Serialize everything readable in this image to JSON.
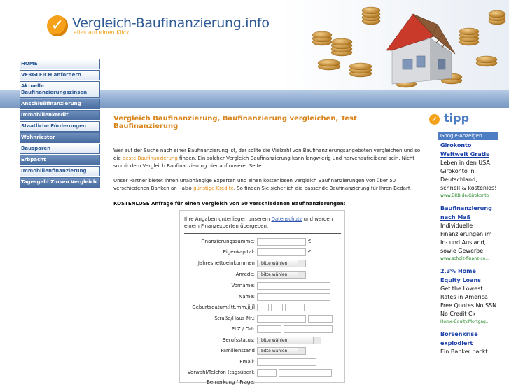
{
  "header": {
    "logo_title": "Vergleich-Baufinanzierung.info",
    "logo_tagline": "alles auf einen Klick."
  },
  "menu": {
    "items": [
      {
        "label": "HOME"
      },
      {
        "label": "VERGLEICH anfordern"
      },
      {
        "label": "Aktuelle Baufinanzierungszinsen"
      },
      {
        "label": "Anschlußfinanzierung"
      },
      {
        "label": "Immobilienkredit"
      },
      {
        "label": "Staatliche Förderungen"
      },
      {
        "label": "Wohnriester"
      },
      {
        "label": "Bausparen"
      },
      {
        "label": "Erbpacht"
      },
      {
        "label": "Immobilienfinanzierung"
      },
      {
        "label": "Tagesgeld Zinsen Vergleich"
      }
    ]
  },
  "main": {
    "title": "Vergleich Baufinanzierung, Baufinanzierung vergleichen, Test Baufinanzierung",
    "para1_a": "Wer auf der Suche nach einer Baufinanzierung ist, der sollte die Vielzahl von Baufinanzierungsangeboten vergleichen und so die ",
    "para1_link": "beste Baufinanzierung",
    "para1_b": " finden. Ein solcher Vergleich Baufinanzierung kann langwierig und nervenaufreibend sein. Nicht so mit dem Vergleich Baufinanzierung hier auf unserer Seite.",
    "para2_a": "Unser Partner bietet Ihnen unabhängige Experten und einen kostenlosen Vergleich Baufinanzierungen von über 50 verschiedenen Banken an - also ",
    "para2_link": "günstige Kredite",
    "para2_b": ". So finden Sie sicherlich die passende Baufinanzierung für Ihren Bedarf.",
    "form_heading": "KOSTENLOSE Anfrage für einen Vergleich von 50 verschiedenen Baufinanzierungen:"
  },
  "form": {
    "intro_a": "Ihre Angaben unterliegen unserem ",
    "intro_link": "Datenschutz",
    "intro_b": " und werden einem Finanzexperten übergeben.",
    "labels": {
      "finanzierungssumme": "Finanzierungssumme:",
      "eigenkapital": "Eigenkapital:",
      "jahresnetto": "Jahresnettoeinkommen",
      "anrede": "Anrede:",
      "vorname": "Vorname:",
      "name": "Name:",
      "geburtsdatum": "Geburtsdatum:[tt.mm.jjjj]",
      "strasse": "Straße/Haus-Nr.:",
      "plz": "PLZ / Ort:",
      "berufsstatus": "Berufsstatus:",
      "familienstand": "Familienstand",
      "email": "Email:",
      "telefon": "Vorwahl/Telefon (tagsüber):",
      "bemerkung": "Bemerkung / Frage:"
    },
    "euro": "€",
    "select_placeholder": "bitte wählen"
  },
  "sidebar_right": {
    "tipp": "tipp",
    "ads_header": "Google-Anzeigen",
    "ads": [
      {
        "title": "Girokonto Weltweit Gratis",
        "body": "Leben in den USA, Girokonto in Deutschland, schnell & kostenlos!",
        "url": "www.DKB.de/Girokonto"
      },
      {
        "title": "Individuelle Baufinanzierung nach Maß",
        "title_short": "Baufinanzierung nach Maß",
        "body": "Individuelle Finanzierungen im In- und Ausland, sowie Gewerbe",
        "url": "www.scholz-finanz-co..."
      },
      {
        "title": "2.3% Home Equity Loans",
        "body": "Get the Lowest Rates in America! Free Quotes No SSN No Credit Ck",
        "url": "Home-Equity.Mortgag..."
      },
      {
        "title": "Börsenkrise explodiert",
        "body": "Ein Banker packt",
        "url": ""
      }
    ]
  }
}
